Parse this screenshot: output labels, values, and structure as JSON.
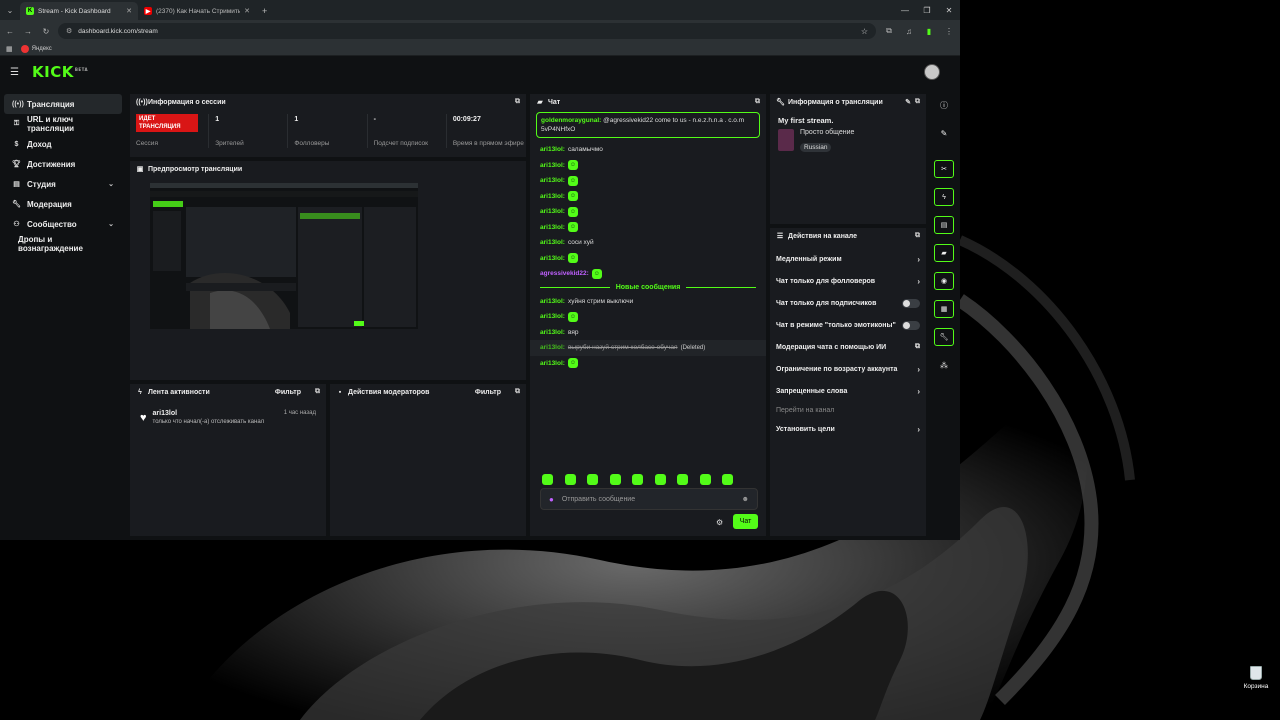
{
  "browser": {
    "tabs": [
      {
        "title": "Stream - Kick Dashboard",
        "active": true
      },
      {
        "title": "(2370) Как Начать Стримить н",
        "active": false
      }
    ],
    "url": "dashboard.kick.com/stream",
    "bookmark": "Яндекс"
  },
  "header": {
    "logo": "KICK",
    "logo_badge": "BETA"
  },
  "sidebar": {
    "items": [
      {
        "label": "Трансляция",
        "icon": "broadcast-icon"
      },
      {
        "label": "URL и ключ трансляции",
        "icon": "key-icon"
      },
      {
        "label": "Доход",
        "icon": "dollar-icon"
      },
      {
        "label": "Достижения",
        "icon": "trophy-icon"
      },
      {
        "label": "Студия",
        "icon": "studio-icon"
      },
      {
        "label": "Модерация",
        "icon": "wrench-icon"
      },
      {
        "label": "Сообщество",
        "icon": "community-icon"
      },
      {
        "label": "Дропы и вознаграждение",
        "icon": ""
      }
    ]
  },
  "session": {
    "title": "Информация о сессии",
    "live_badge": "ИДЕТ ТРАНСЛЯЦИЯ",
    "session_label": "Сессия",
    "stats": [
      {
        "value": "1",
        "label": "Зрителей"
      },
      {
        "value": "1",
        "label": "Фолловеры"
      },
      {
        "value": "-",
        "label": "Подсчет подписок"
      },
      {
        "value": "00:09:27",
        "label": "Время в прямом эфире"
      }
    ]
  },
  "preview": {
    "title": "Предпросмотр трансляции"
  },
  "activity": {
    "title": "Лента активности",
    "filter": "Фильтр",
    "events": [
      {
        "user": "ari13lol",
        "text": "только что начал(-а) отслеживать канал",
        "time": "1 час назад"
      }
    ]
  },
  "modactions": {
    "title": "Действия модераторов",
    "filter": "Фильтр"
  },
  "chat": {
    "title": "Чат",
    "pinned": {
      "user": "goldenmoraygunal:",
      "text": "@agressivekid22 come to us - n.e.z.h.n.a . c.o.m 5vP4NHfxO"
    },
    "messages_before": [
      {
        "user": "ari13lol:",
        "text": "саламычмо",
        "emote": false
      },
      {
        "user": "ari13lol:",
        "text": "",
        "emote": true
      },
      {
        "user": "ari13lol:",
        "text": "",
        "emote": true
      },
      {
        "user": "ari13lol:",
        "text": "",
        "emote": true
      },
      {
        "user": "ari13lol:",
        "text": "",
        "emote": true
      },
      {
        "user": "ari13lol:",
        "text": "",
        "emote": true
      },
      {
        "user": "ari13lol:",
        "text": "соси хуй",
        "emote": false
      },
      {
        "user": "ari13lol:",
        "text": "",
        "emote": true
      },
      {
        "user": "agressivekid22:",
        "text": "",
        "emote": true,
        "purple": true
      }
    ],
    "new_divider": "Новые сообщения",
    "messages_after": [
      {
        "user": "ari13lol:",
        "text": "хуйня стрим выключи",
        "emote": false
      },
      {
        "user": "ari13lol:",
        "text": "",
        "emote": true
      },
      {
        "user": "ari13lol:",
        "text": "вяр",
        "emote": false
      }
    ],
    "deleted": {
      "user": "ari13lol:",
      "text": "выруби назуй стрим колбасе обучая",
      "tag": "(Deleted)"
    },
    "last": {
      "user": "ari13lol:"
    },
    "input_placeholder": "Отправить сообщение",
    "send_label": "Чат"
  },
  "stream_info": {
    "title": "Информация о трансляции",
    "stream_title": "My first stream.",
    "category": "Просто общение",
    "tag": "Russian"
  },
  "channel_actions": {
    "title": "Действия на канале",
    "items": [
      {
        "label": "Медленный режим",
        "kind": "chevron"
      },
      {
        "label": "Чат только для фолловеров",
        "kind": "chevron"
      },
      {
        "label": "Чат только для подписчиков",
        "kind": "toggle"
      },
      {
        "label": "Чат в режиме \"только эмотиконы\"",
        "kind": "toggle"
      },
      {
        "label": "Модерация чата с помощью ИИ",
        "kind": "external"
      },
      {
        "label": "Ограничение по возрасту аккаунта",
        "kind": "chevron"
      },
      {
        "label": "Запрещенные слова",
        "kind": "chevron"
      },
      {
        "label": "Перейти на канал",
        "kind": "muted"
      },
      {
        "label": "Установить цели",
        "kind": "chevron"
      }
    ]
  },
  "desktop": {
    "recycle_bin": "Корзина"
  },
  "colors": {
    "accent": "#53fc18",
    "live": "#d91515",
    "panel": "#191b1f",
    "background": "#0f1113"
  }
}
